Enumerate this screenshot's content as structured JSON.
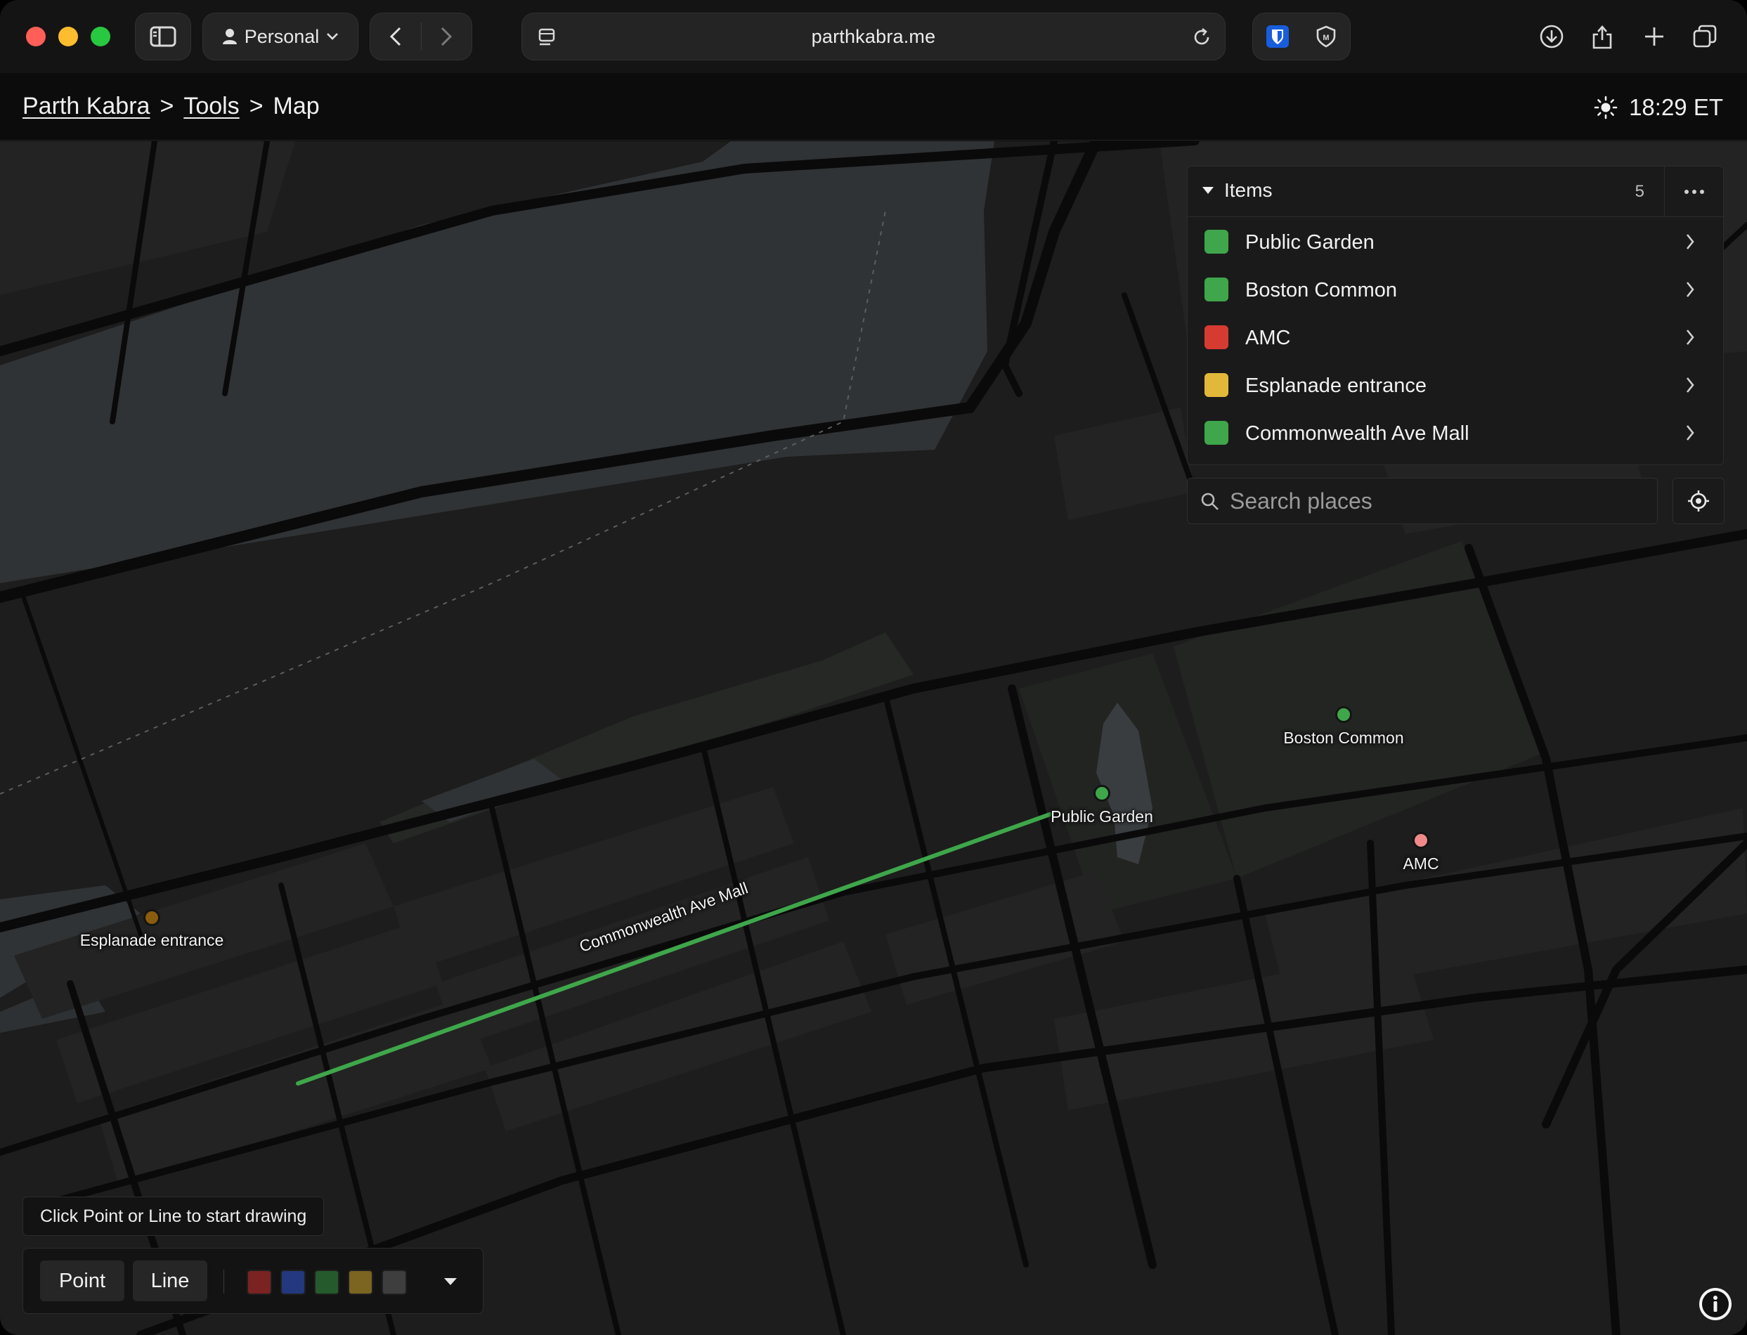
{
  "browser": {
    "profile_label": "Personal",
    "url": "parthkabra.me"
  },
  "header": {
    "breadcrumb": [
      "Parth Kabra",
      "Tools",
      "Map"
    ],
    "separator": ">",
    "clock": "18:29 ET"
  },
  "items_panel": {
    "title": "Items",
    "count": "5",
    "items": [
      {
        "label": "Public Garden",
        "color": "#3fa64b"
      },
      {
        "label": "Boston Common",
        "color": "#3fa64b"
      },
      {
        "label": "AMC",
        "color": "#d63b32"
      },
      {
        "label": "Esplanade entrance",
        "color": "#e2b83a"
      },
      {
        "label": "Commonwealth Ave Mall",
        "color": "#3fa64b"
      }
    ]
  },
  "search": {
    "placeholder": "Search places"
  },
  "map": {
    "markers": [
      {
        "label": "Public Garden",
        "color": "#3fa64b"
      },
      {
        "label": "Boston Common",
        "color": "#3fa64b"
      },
      {
        "label": "AMC",
        "color": "#f08a8a"
      },
      {
        "label": "Esplanade entrance",
        "color": "#8a5c0e"
      }
    ],
    "line": {
      "label": "Commonwealth Ave Mall",
      "color": "#3fa64b"
    }
  },
  "drawing": {
    "hint": "Click Point or Line to start drawing",
    "point_label": "Point",
    "line_label": "Line",
    "swatches": [
      "#7a2322",
      "#24387f",
      "#255b2c",
      "#7c6421",
      "#3e3e3e"
    ]
  },
  "icons": {
    "sidebar": "sidebar-icon",
    "profile": "person-icon",
    "back": "chevron-left-icon",
    "forward": "chevron-right-icon",
    "reload": "reload-icon",
    "extensions": [
      "bitwarden-icon",
      "privacy-shield-icon"
    ],
    "right": [
      "download-icon",
      "share-icon",
      "new-tab-icon",
      "tabs-overview-icon"
    ],
    "theme": "sun-icon",
    "search": "search-icon",
    "locate": "locate-icon",
    "info": "info-icon"
  }
}
